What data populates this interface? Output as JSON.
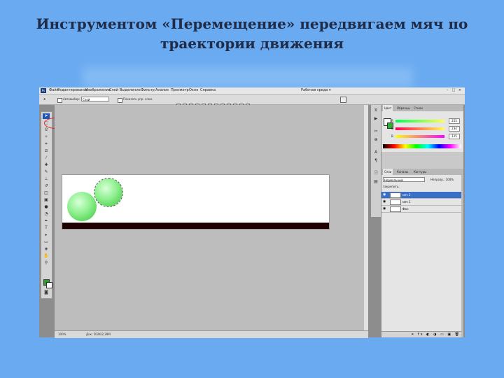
{
  "slide": {
    "title": "Инструментом «Перемещение» передвигаем мяч по траектории движения"
  },
  "app": {
    "logo": "Ps",
    "menu": [
      "Файл",
      "Редактирование",
      "Изображение",
      "Слой",
      "Выделение",
      "Фильтр",
      "Анализ",
      "Просмотр",
      "Окно",
      "Справка"
    ],
    "workspace": "Рабочая среда ▾",
    "window_buttons": [
      "–",
      "□",
      "×"
    ]
  },
  "options": {
    "autoselect_label": "Автовыбор:",
    "autoselect_value": "Слой",
    "transform_label": "Показать упр. элем."
  },
  "canvas": {
    "ground_color": "#200000",
    "ball_color": "#8ef08e"
  },
  "status": {
    "zoom": "100%",
    "doc": "Док: 502К/2,39M"
  },
  "panels": {
    "color_tabs": [
      "Цвет",
      "Образцы",
      "Стили"
    ],
    "channels": [
      {
        "label": "R",
        "value": "255"
      },
      {
        "label": "G",
        "value": "234"
      },
      {
        "label": "B",
        "value": "115"
      }
    ],
    "layer_tabs": [
      "Слои",
      "Каналы",
      "Контуры"
    ],
    "blend_mode": "Нормальный",
    "opacity": "Непрозр.: 100%",
    "lock": "Закрепить:",
    "layers": [
      {
        "name": "мяч 2",
        "selected": true
      },
      {
        "name": "мяч 1",
        "selected": false
      },
      {
        "name": "Фон",
        "selected": false
      }
    ],
    "footer_icons": "⚭ fx ◐ ◑ ▭ ▣ 🗑"
  }
}
